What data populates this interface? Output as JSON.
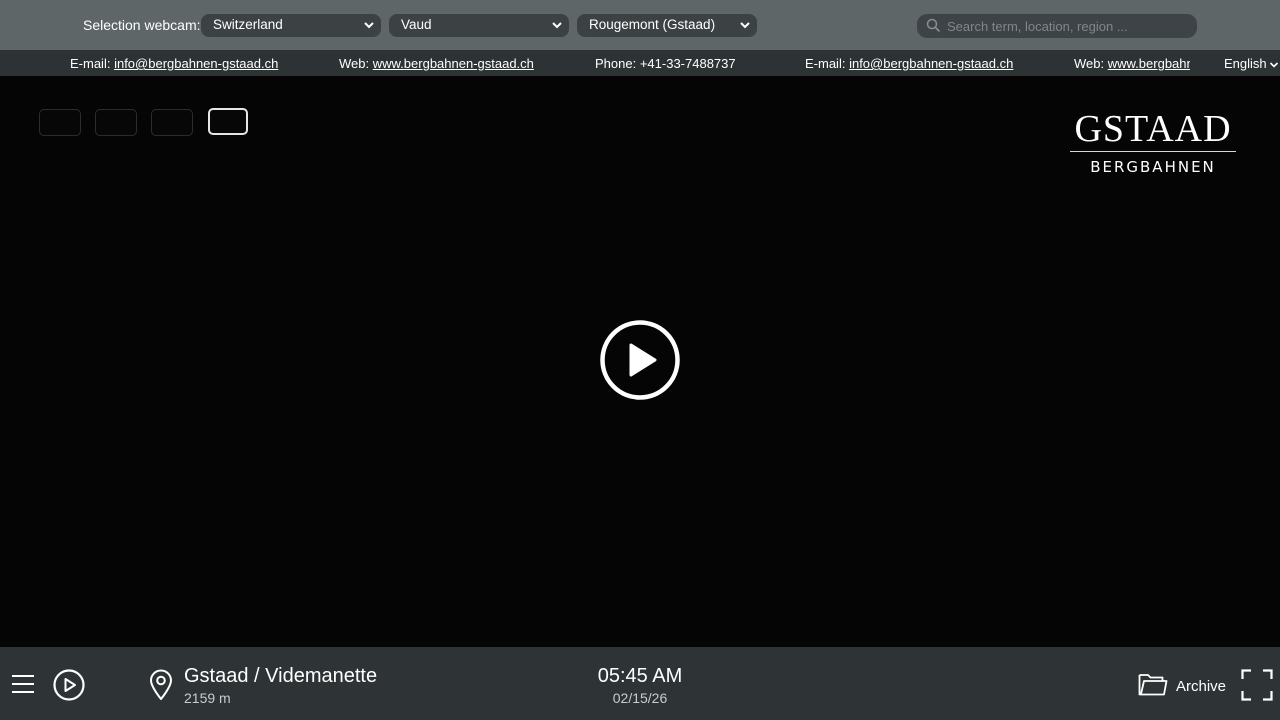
{
  "topbar": {
    "selection_label": "Selection webcam:",
    "country": "Switzerland",
    "region": "Vaud",
    "place": "Rougemont (Gstaad)",
    "search_placeholder": "Search term, location, region ..."
  },
  "infobar": {
    "email_label": "E-mail:",
    "email": "info@bergbahnen-gstaad.ch",
    "web_label": "Web:",
    "web": "www.bergbahnen-gstaad.ch",
    "phone_label": "Phone:",
    "phone": "+41-33-7488737",
    "email_label_2": "E-mail:",
    "email_2": "info@bergbahnen-gstaad.ch",
    "web_label_2": "Web:",
    "web_2": "www.bergbahnen-gstaad.ch",
    "language": "English"
  },
  "logo": {
    "brand": "GSTAAD",
    "sub": "BERGBAHNEN"
  },
  "bottombar": {
    "location_title": "Gstaad / Videmanette",
    "altitude": "2159 m",
    "time": "05:45 AM",
    "date": "02/15/26",
    "archive_label": "Archive"
  },
  "icons": {
    "play_large": "play-circle-icon",
    "play_small": "play-circle-icon",
    "menu": "hamburger-icon",
    "location": "map-pin-icon",
    "archive": "folder-icon",
    "fullscreen": "fullscreen-icon",
    "search": "search-icon"
  }
}
